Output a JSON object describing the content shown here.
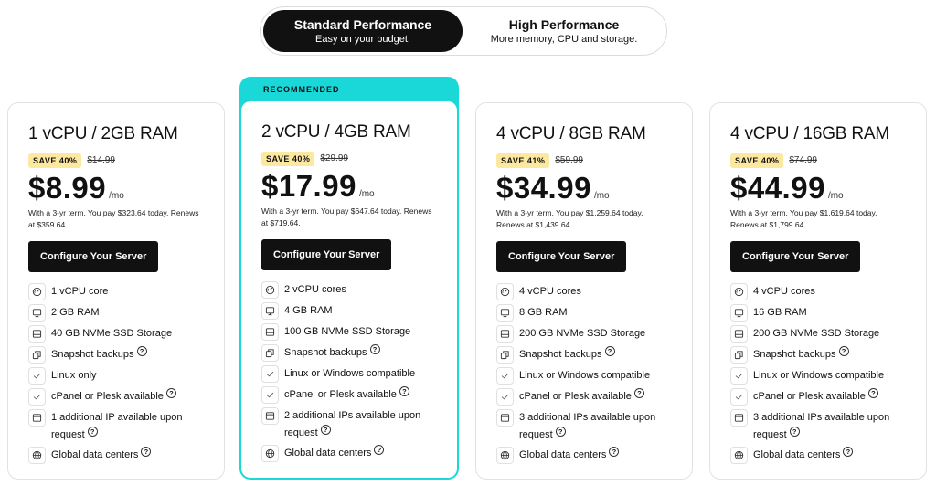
{
  "toggle": {
    "options": [
      {
        "title": "Standard Performance",
        "subtitle": "Easy on your budget.",
        "active": true
      },
      {
        "title": "High Performance",
        "subtitle": "More memory, CPU and storage.",
        "active": false
      }
    ]
  },
  "recommended_label": "RECOMMENDED",
  "colors": {
    "accent": "#1ad8d8",
    "badge": "#fde8a0",
    "button": "#111111"
  },
  "help_glyph": "?",
  "plans": [
    {
      "title": "1 vCPU / 2GB RAM",
      "save": "SAVE 40%",
      "old_price": "$14.99",
      "price": "$8.99",
      "per": "/mo",
      "terms": "With a 3-yr term. You pay $323.64 today. Renews at $359.64.",
      "cta": "Configure Your Server",
      "features": [
        {
          "icon": "gauge-icon",
          "text": "1 vCPU core",
          "help": false
        },
        {
          "icon": "monitor-icon",
          "text": "2 GB RAM",
          "help": false
        },
        {
          "icon": "drive-icon",
          "text": "40 GB NVMe SSD Storage",
          "help": false
        },
        {
          "icon": "copy-icon",
          "text": "Snapshot backups",
          "help": true
        },
        {
          "icon": "check-icon",
          "text": "Linux only",
          "help": false
        },
        {
          "icon": "check-icon",
          "text": "cPanel or Plesk available",
          "help": true
        },
        {
          "icon": "window-icon",
          "text": "1 additional IP available upon request",
          "help": true
        },
        {
          "icon": "globe-icon",
          "text": "Global data centers",
          "help": true
        }
      ]
    },
    {
      "title": "2 vCPU / 4GB RAM",
      "save": "SAVE 40%",
      "old_price": "$29.99",
      "price": "$17.99",
      "per": "/mo",
      "terms": "With a 3-yr term. You pay $647.64 today. Renews at $719.64.",
      "cta": "Configure Your Server",
      "features": [
        {
          "icon": "gauge-icon",
          "text": "2 vCPU cores",
          "help": false
        },
        {
          "icon": "monitor-icon",
          "text": "4 GB RAM",
          "help": false
        },
        {
          "icon": "drive-icon",
          "text": "100 GB NVMe SSD Storage",
          "help": false
        },
        {
          "icon": "copy-icon",
          "text": "Snapshot backups",
          "help": true
        },
        {
          "icon": "check-icon",
          "text": "Linux or Windows compatible",
          "help": false
        },
        {
          "icon": "check-icon",
          "text": "cPanel or Plesk available",
          "help": true
        },
        {
          "icon": "window-icon",
          "text": "2 additional IPs available upon request",
          "help": true
        },
        {
          "icon": "globe-icon",
          "text": "Global data centers",
          "help": true
        }
      ]
    },
    {
      "title": "4 vCPU / 8GB RAM",
      "save": "SAVE 41%",
      "old_price": "$59.99",
      "price": "$34.99",
      "per": "/mo",
      "terms": "With a 3-yr term. You pay $1,259.64 today. Renews at $1,439.64.",
      "cta": "Configure Your Server",
      "features": [
        {
          "icon": "gauge-icon",
          "text": "4 vCPU cores",
          "help": false
        },
        {
          "icon": "monitor-icon",
          "text": "8 GB RAM",
          "help": false
        },
        {
          "icon": "drive-icon",
          "text": "200 GB NVMe SSD Storage",
          "help": false
        },
        {
          "icon": "copy-icon",
          "text": "Snapshot backups",
          "help": true
        },
        {
          "icon": "check-icon",
          "text": "Linux or Windows compatible",
          "help": false
        },
        {
          "icon": "check-icon",
          "text": "cPanel or Plesk available",
          "help": true
        },
        {
          "icon": "window-icon",
          "text": "3 additional IPs available upon request",
          "help": true
        },
        {
          "icon": "globe-icon",
          "text": "Global data centers",
          "help": true
        }
      ]
    },
    {
      "title": "4 vCPU / 16GB RAM",
      "save": "SAVE 40%",
      "old_price": "$74.99",
      "price": "$44.99",
      "per": "/mo",
      "terms": "With a 3-yr term. You pay $1,619.64 today. Renews at $1,799.64.",
      "cta": "Configure Your Server",
      "features": [
        {
          "icon": "gauge-icon",
          "text": "4 vCPU cores",
          "help": false
        },
        {
          "icon": "monitor-icon",
          "text": "16 GB RAM",
          "help": false
        },
        {
          "icon": "drive-icon",
          "text": "200 GB NVMe SSD Storage",
          "help": false
        },
        {
          "icon": "copy-icon",
          "text": "Snapshot backups",
          "help": true
        },
        {
          "icon": "check-icon",
          "text": "Linux or Windows compatible",
          "help": false
        },
        {
          "icon": "check-icon",
          "text": "cPanel or Plesk available",
          "help": true
        },
        {
          "icon": "window-icon",
          "text": "3 additional IPs available upon request",
          "help": true
        },
        {
          "icon": "globe-icon",
          "text": "Global data centers",
          "help": true
        }
      ]
    }
  ]
}
